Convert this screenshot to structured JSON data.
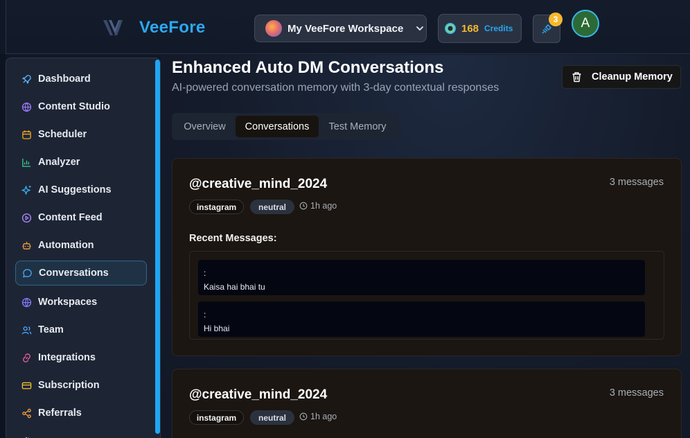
{
  "app": {
    "name": "VeeFore"
  },
  "header": {
    "workspace_label": "My VeeFore Workspace",
    "credits_value": "168",
    "credits_label": "Credits",
    "notification_count": "3",
    "user_initial": "A"
  },
  "sidebar": {
    "items": [
      {
        "label": "Dashboard",
        "icon": "rocket-icon",
        "color": "#5fb4ff"
      },
      {
        "label": "Content Studio",
        "icon": "palette-icon",
        "color": "#a07cff"
      },
      {
        "label": "Scheduler",
        "icon": "calendar-icon",
        "color": "#f5a623"
      },
      {
        "label": "Analyzer",
        "icon": "bar-chart-icon",
        "color": "#3ccf8e"
      },
      {
        "label": "AI Suggestions",
        "icon": "sparkles-icon",
        "color": "#3ab8f5"
      },
      {
        "label": "Content Feed",
        "icon": "play-circle-icon",
        "color": "#b48cff"
      },
      {
        "label": "Automation",
        "icon": "bot-icon",
        "color": "#f59e3b"
      },
      {
        "label": "Conversations",
        "icon": "message-circle-icon",
        "color": "#4aa8ff"
      },
      {
        "label": "Workspaces",
        "icon": "globe-icon",
        "color": "#8d7cff"
      },
      {
        "label": "Team",
        "icon": "users-icon",
        "color": "#4aa8ff"
      },
      {
        "label": "Integrations",
        "icon": "link-icon",
        "color": "#f05fa0"
      },
      {
        "label": "Subscription",
        "icon": "credit-card-icon",
        "color": "#f5c12e"
      },
      {
        "label": "Referrals",
        "icon": "share-icon",
        "color": "#f59e3b"
      }
    ],
    "active_index": 7
  },
  "page": {
    "title": "Enhanced Auto DM Conversations",
    "subtitle": "AI-powered conversation memory with 3-day contextual responses",
    "cleanup_label": "Cleanup Memory",
    "tabs": [
      {
        "label": "Overview"
      },
      {
        "label": "Conversations"
      },
      {
        "label": "Test Memory"
      }
    ],
    "active_tab": 1
  },
  "conversations": [
    {
      "username": "@creative_mind_2024",
      "message_count": "3 messages",
      "platform": "instagram",
      "sentiment": "neutral",
      "time": "1h ago",
      "recent_label": "Recent Messages:",
      "messages": [
        {
          "sender": ":",
          "text": "Kaisa hai bhai tu"
        },
        {
          "sender": ":",
          "text": "Hi bhai"
        }
      ]
    },
    {
      "username": "@creative_mind_2024",
      "message_count": "3 messages",
      "platform": "instagram",
      "sentiment": "neutral",
      "time": "1h ago"
    }
  ],
  "colors": {
    "brand": "#2aa9f2",
    "credits": "#f5b82e",
    "card_bg": "#1b1612",
    "sidebar_bg": "#1d2535"
  }
}
